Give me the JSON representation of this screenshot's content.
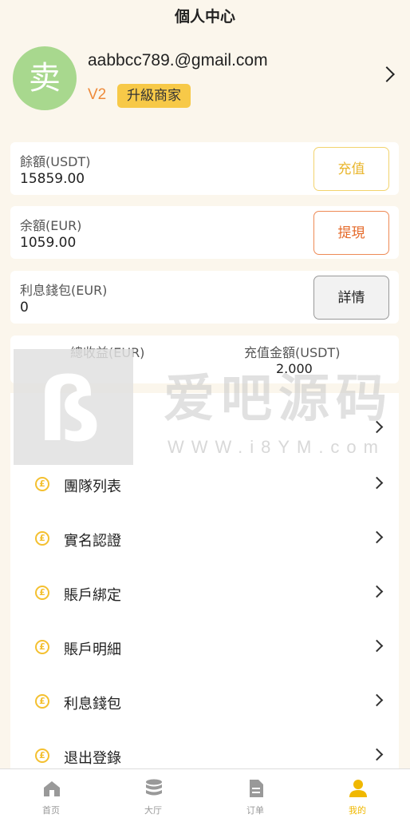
{
  "header": {
    "title": "個人中心"
  },
  "profile": {
    "avatar_char": "卖",
    "email": "aabbcc789.@gmail.com",
    "level": "V2",
    "upgrade_label": "升級商家"
  },
  "balances": [
    {
      "label": "餘額(USDT)",
      "value": "15859.00",
      "button": "充值"
    },
    {
      "label": "余額(EUR)",
      "value": "1059.00",
      "button": "提現"
    },
    {
      "label": "利息錢包(EUR)",
      "value": "0",
      "button": "詳情"
    }
  ],
  "stats": {
    "left_label": "總收益(EUR)",
    "right_label": "充值金額(USDT)",
    "right_value": "2.000"
  },
  "menu": [
    {
      "label": ""
    },
    {
      "label": "團隊列表"
    },
    {
      "label": "實名認證"
    },
    {
      "label": "賬戶綁定"
    },
    {
      "label": "賬戶明細"
    },
    {
      "label": "利息錢包"
    },
    {
      "label": "退出登錄"
    }
  ],
  "watermark": {
    "text": "爱吧源码",
    "url": "WWW.i8YM.com"
  },
  "nav": [
    {
      "label": "首页",
      "icon": "home-icon"
    },
    {
      "label": "大厅",
      "icon": "database-icon"
    },
    {
      "label": "订单",
      "icon": "document-icon"
    },
    {
      "label": "我的",
      "icon": "user-icon"
    }
  ],
  "colors": {
    "accent": "#f7c948",
    "avatar": "#a8d88e",
    "active": "#f0b800"
  }
}
